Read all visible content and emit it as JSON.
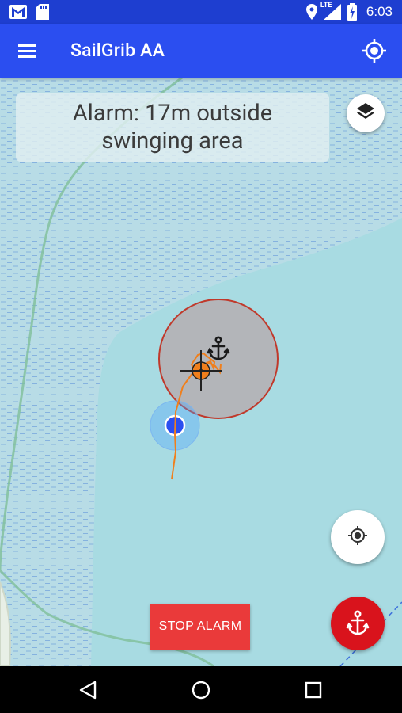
{
  "status_bar": {
    "time": "6:03",
    "network_label": "LTE",
    "icons": [
      "gmail-icon",
      "sd-card-icon",
      "location-icon",
      "signal-icon",
      "battery-charging-icon"
    ]
  },
  "app_bar": {
    "title": "SailGrib AA",
    "menu_icon": "hamburger-menu-icon",
    "locate_icon": "gps-fixed-icon"
  },
  "alarm": {
    "line1": "Alarm: 17m outside",
    "line2": "swinging area"
  },
  "buttons": {
    "stop_alarm": "STOP ALARM",
    "layers_icon": "layers-icon",
    "center_icon": "my-location-icon",
    "anchor_icon": "anchor-icon"
  },
  "colors": {
    "status_bar": "#1e3ed0",
    "app_bar": "#2b4ef0",
    "water": "#a8dbe2",
    "swing_circle_stroke": "#c0392b",
    "track": "#f07f1c",
    "stop_button": "#ea3a3a",
    "anchor_fab": "#d9131c"
  },
  "nav_bar": {
    "back": "back-icon",
    "home": "home-icon",
    "recents": "recents-icon"
  }
}
